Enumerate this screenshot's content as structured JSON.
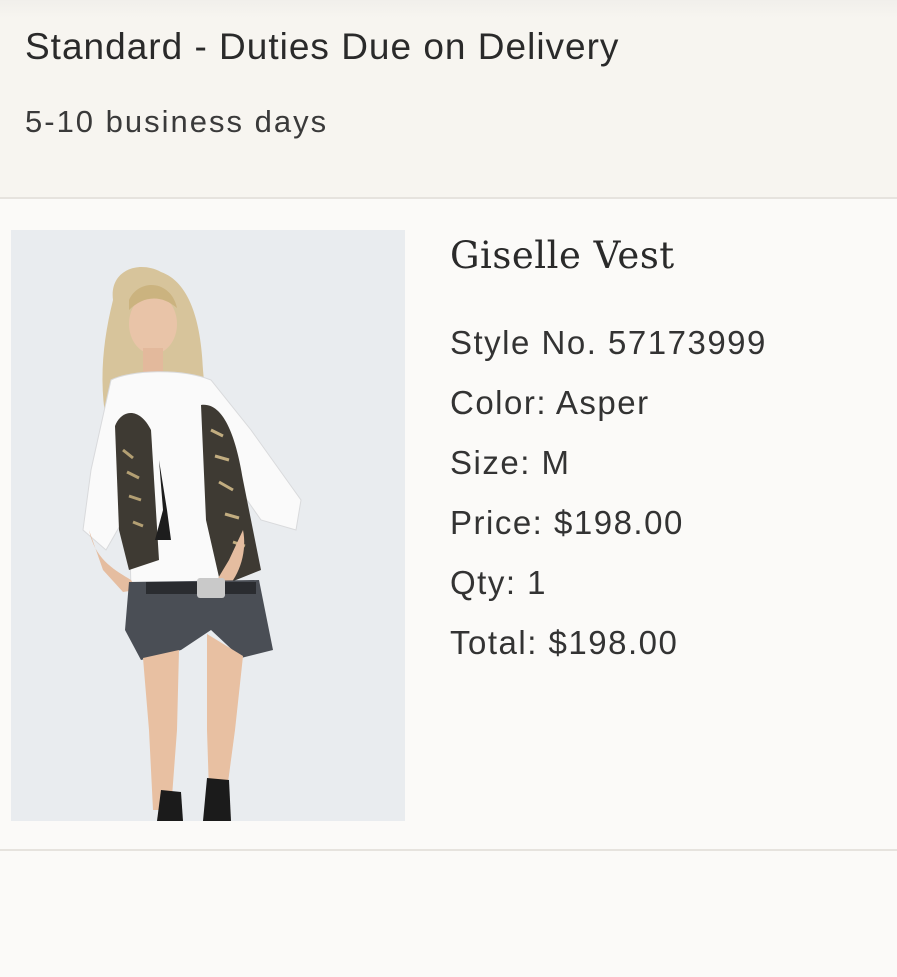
{
  "shipping": {
    "method": "Standard - Duties Due on Delivery",
    "time": "5-10 business days"
  },
  "product": {
    "image_icon": "product-photo",
    "name": "Giselle Vest",
    "details": {
      "style": "Style No. 57173999",
      "color": "Color: Asper",
      "size": "Size: M",
      "price": "Price: $198.00",
      "qty": "Qty: 1",
      "total": "Total: $198.00"
    }
  }
}
